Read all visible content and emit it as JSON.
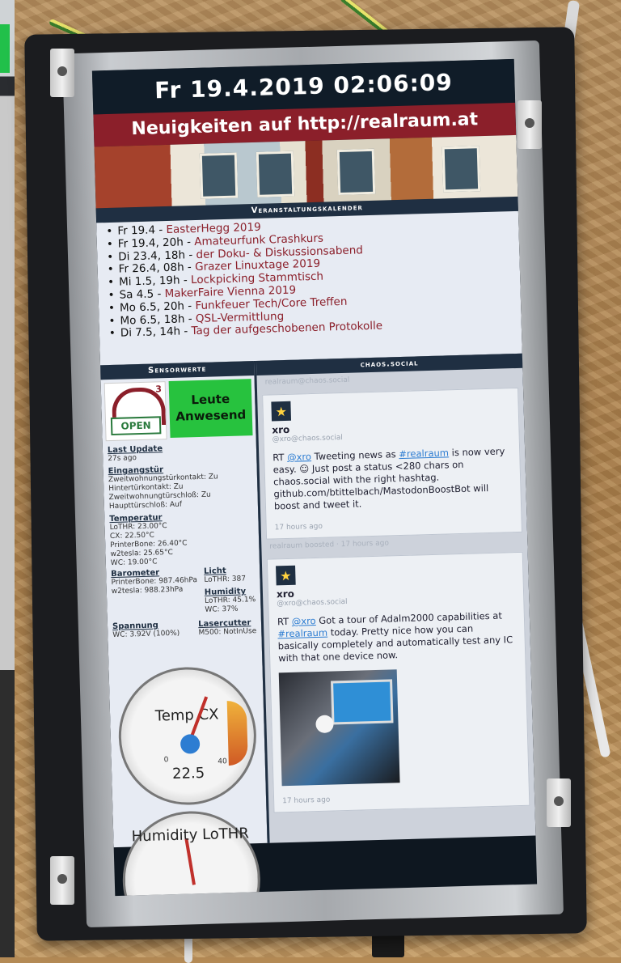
{
  "screen": {
    "clock": "Fr 19.4.2019 02:06:09",
    "news": "Neuigkeiten auf http://realraum.at"
  },
  "calendar": {
    "heading": "Veranstaltungskalender",
    "events": [
      {
        "date": "Fr 19.4",
        "title": "EasterHegg 2019"
      },
      {
        "date": "Fr 19.4, 20h",
        "title": "Amateurfunk Crashkurs"
      },
      {
        "date": "Di 23.4, 18h",
        "title": "der Doku- & Diskussionsabend"
      },
      {
        "date": "Fr 26.4, 08h",
        "title": "Grazer Linuxtage 2019"
      },
      {
        "date": "Mi 1.5, 19h",
        "title": "Lockpicking Stammtisch"
      },
      {
        "date": "Sa 4.5",
        "title": "MakerFaire Vienna 2019"
      },
      {
        "date": "Mo 6.5, 20h",
        "title": "Funkfeuer Tech/Core Treffen"
      },
      {
        "date": "Mo 6.5, 18h",
        "title": "QSL-Vermittlung"
      },
      {
        "date": "Di 7.5, 14h",
        "title": "Tag der aufgeschobenen Protokolle"
      }
    ]
  },
  "sensors": {
    "heading": "Sensorwerte",
    "badge_sup": "3",
    "open_label": "OPEN",
    "presence": "Leute Anwesend",
    "last_update": {
      "label": "Last Update",
      "value": "27s ago"
    },
    "door": {
      "label": "Eingangstür",
      "lines": [
        "Zweitwohnungstürkontakt: Zu",
        "Hintertürkontakt: Zu",
        "Zweitwohnungtürschloß: Zu",
        "Haupttürschloß: Auf"
      ]
    },
    "temperature": {
      "label": "Temperatur",
      "lines": [
        "LoTHR: 23.00°C",
        "CX: 22.50°C",
        "PrinterBone: 26.40°C",
        "w2tesla: 25.65°C",
        "WC: 19.00°C"
      ]
    },
    "barometer": {
      "label": "Barometer",
      "lines": [
        "PrinterBone: 987.46hPa",
        "w2tesla: 988.23hPa"
      ]
    },
    "light": {
      "label": "Licht",
      "lines": [
        "LoTHR: 387"
      ]
    },
    "humidity": {
      "label": "Humidity",
      "lines": [
        "LoTHR: 45.1%",
        "WC: 37%"
      ]
    },
    "voltage": {
      "label": "Spannung",
      "lines": [
        "WC: 3.92V (100%)"
      ]
    },
    "lasercutter": {
      "label": "Lasercutter",
      "lines": [
        "M500: NotInUse"
      ]
    },
    "gauge1": {
      "label": "Temp CX",
      "value": "22.5",
      "tick_low": "0",
      "tick_high": "40"
    },
    "gauge2": {
      "label": "Humidity LoTHR"
    }
  },
  "social": {
    "heading": "chaos.social",
    "toots": [
      {
        "name": "xro",
        "handle": "@xro@chaos.social",
        "text_pre": "RT ",
        "mention": "@xro",
        "text_mid": " Tweeting news as ",
        "hashtag": "#realraum",
        "text_post": " is now very easy. ☺ Just post a status <280 chars on chaos.social with the right hashtag. github.com/btittelbach/MastodonBoostBot will boost and tweet it.",
        "time": "17 hours ago"
      },
      {
        "name": "xro",
        "handle": "@xro@chaos.social",
        "text_pre": "RT ",
        "mention": "@xro",
        "text_mid": " Got a tour of Adalm2000 capabilities at ",
        "hashtag": "#realraum",
        "text_post": " today. Pretty nice how you can basically completely and automatically test any IC with that one device now.",
        "time": "17 hours ago"
      }
    ],
    "faded_top": "realraum@chaos.social",
    "faded_mid": "realraum boosted · 17 hours ago"
  }
}
